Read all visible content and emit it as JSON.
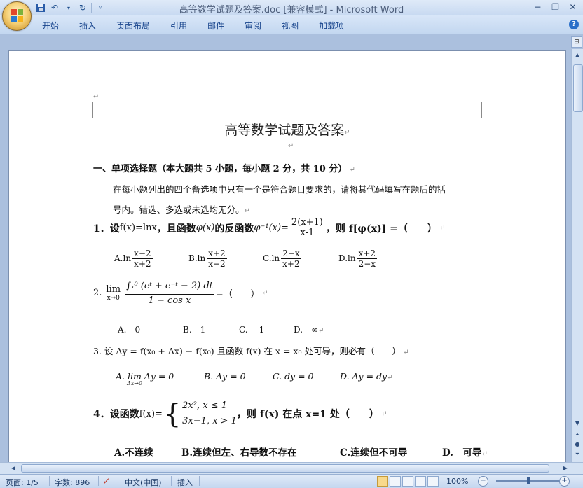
{
  "window": {
    "title": "高等数学试题及答案.doc [兼容模式] - Microsoft Word"
  },
  "qat": {
    "save_icon": "save-icon",
    "undo_icon": "undo-icon",
    "redo_icon": "redo-icon"
  },
  "ribbon": {
    "tabs": [
      "开始",
      "插入",
      "页面布局",
      "引用",
      "邮件",
      "审阅",
      "视图",
      "加载项"
    ]
  },
  "document": {
    "title": "高等数学试题及答案",
    "section1": "一、单项选择题（本大题共 5 小题，每小题 2 分，共 10 分）",
    "instruction_line1": "在每小题列出的四个备选项中只有一个是符合题目要求的，请将其代码填写在题后的括",
    "instruction_line2": "号内。错选、多选或未选均无分。",
    "q1": {
      "prefix": "1．设",
      "func": "f(x)=lnx",
      "mid": "，且函数",
      "phi": "φ(x)",
      "mid2": "的反函数",
      "phi_inv": "φ⁻¹(x)=",
      "num": "2(x+1)",
      "den": "x-1",
      "suffix": "，则 f[φ(x)] =（　　）",
      "options": [
        {
          "label": "A.ln",
          "num": "x−2",
          "den": "x+2"
        },
        {
          "label": "B.ln",
          "num": "x+2",
          "den": "x−2"
        },
        {
          "label": "C.ln",
          "num": "2−x",
          "den": "x+2"
        },
        {
          "label": "D.ln",
          "num": "x+2",
          "den": "2−x"
        }
      ]
    },
    "q2": {
      "prefix": "2.",
      "lim": "lim",
      "lim_sub": "x→0",
      "num": "∫ₓ⁰ (eᵗ + e⁻ᵗ − 2) dt",
      "den": "1 − cos x",
      "suffix": "=（　　）",
      "options": [
        "A.　0",
        "B.　1",
        "C.　-1",
        "D.　∞"
      ]
    },
    "q3": {
      "text": "3. 设 Δy = f(x₀ + Δx) − f(x₀) 且函数 f(x) 在 x = x₀ 处可导，则必有（　　）",
      "options": [
        "A. lim Δy = 0",
        "B. Δy = 0",
        "C. dy = 0",
        "D. Δy = dy"
      ],
      "opt_a_sub": "Δx→0"
    },
    "q4": {
      "prefix": "4．设函数",
      "func": "f(x)=",
      "case1": "2x², x ≤ 1",
      "case2": "3x−1, x > 1",
      "suffix": "，则 f(x) 在点 x=1 处（　　）",
      "options": [
        "A.不连续",
        "B.连续但左、右导数不存在",
        "C.连续但不可导",
        "D.　可导"
      ]
    }
  },
  "status": {
    "page": "页面: 1/5",
    "words": "字数: 896",
    "language": "中文(中国)",
    "mode": "插入",
    "zoom": "100%"
  }
}
